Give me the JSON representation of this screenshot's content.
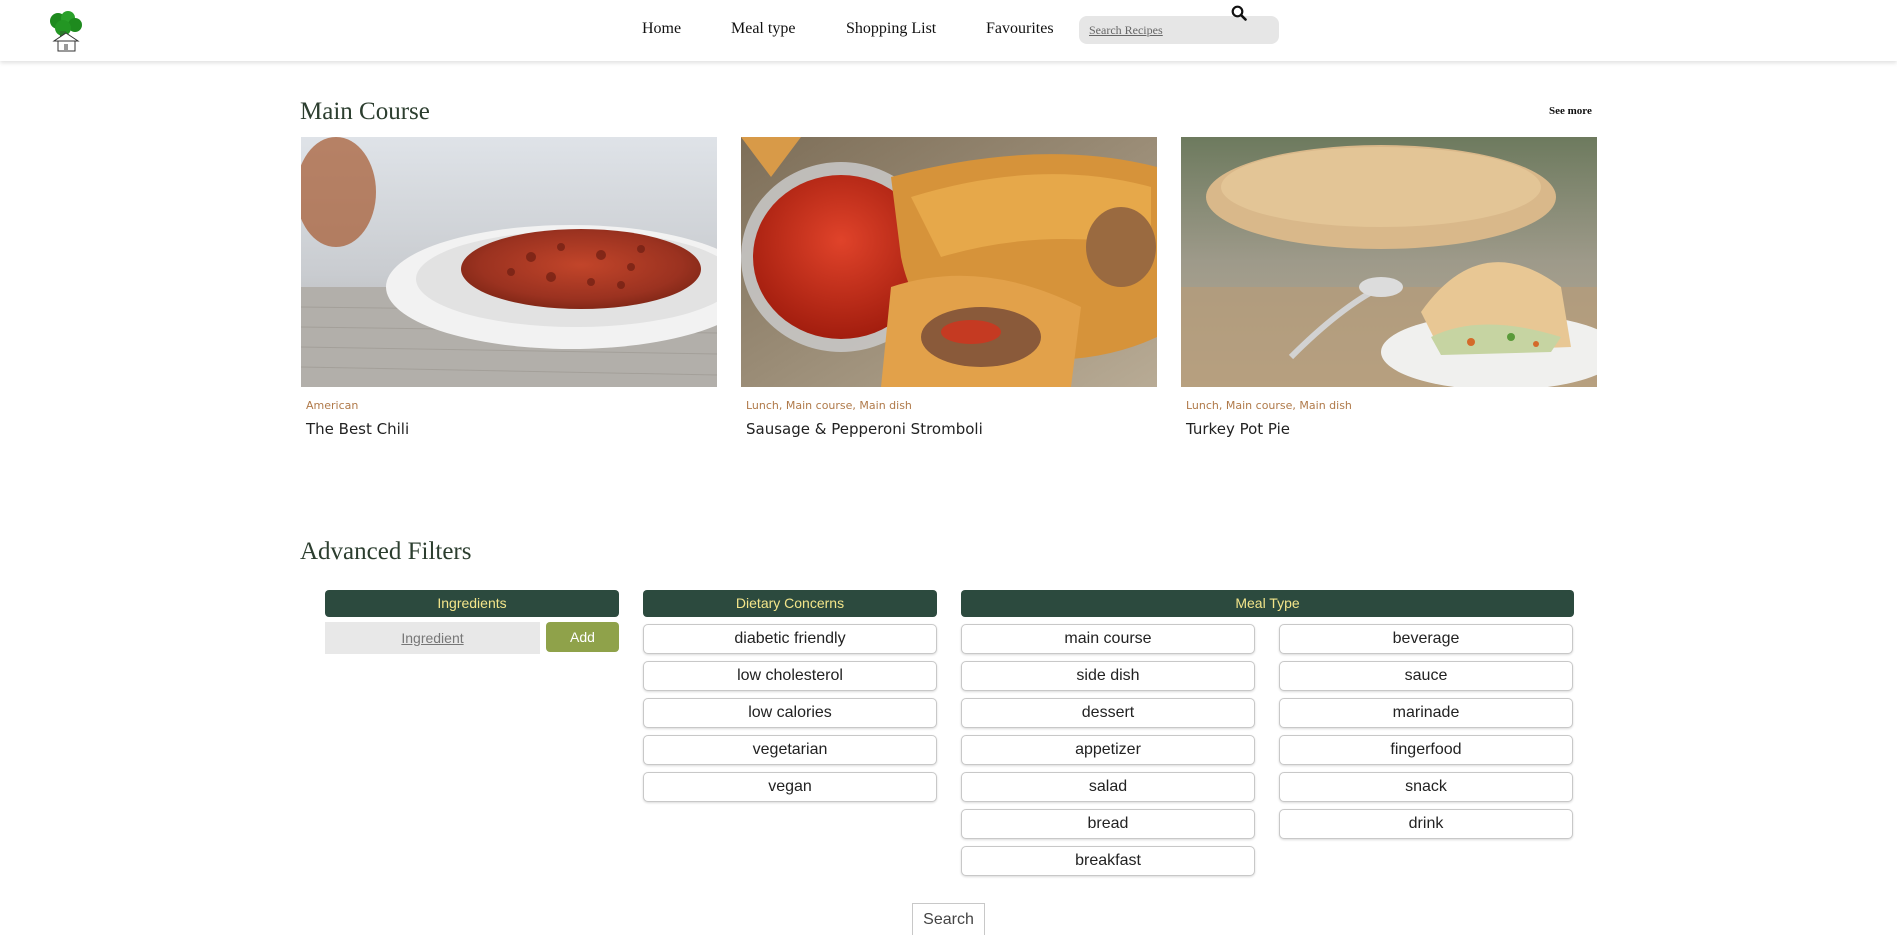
{
  "header": {
    "nav": [
      {
        "label": "Home"
      },
      {
        "label": "Meal type"
      },
      {
        "label": "Shopping List"
      },
      {
        "label": "Favourites"
      }
    ],
    "search": {
      "placeholder": "Search Recipes"
    },
    "logo_icon": "broccoli-house-icon",
    "search_icon": "magnifier-icon"
  },
  "main_course": {
    "title": "Main Course",
    "see_more": "See more",
    "cards": [
      {
        "tags": "American",
        "title": "The Best Chili",
        "image": "chili-bowl-photo"
      },
      {
        "tags": "Lunch, Main course, Main dish",
        "title": "Sausage & Pepperoni Stromboli",
        "image": "stromboli-photo"
      },
      {
        "tags": "Lunch, Main course, Main dish",
        "title": "Turkey Pot Pie",
        "image": "pot-pie-photo"
      }
    ]
  },
  "filters": {
    "title": "Advanced Filters",
    "ingredients": {
      "header": "Ingredients",
      "placeholder": "Ingredient",
      "add_label": "Add"
    },
    "dietary": {
      "header": "Dietary Concerns",
      "options": [
        "diabetic friendly",
        "low cholesterol",
        "low calories",
        "vegetarian",
        "vegan"
      ]
    },
    "meal_type": {
      "header": "Meal Type",
      "col1": [
        "main course",
        "side dish",
        "dessert",
        "appetizer",
        "salad",
        "bread",
        "breakfast"
      ],
      "col2": [
        "beverage",
        "sauce",
        "marinade",
        "fingerfood",
        "snack",
        "drink"
      ]
    },
    "search_label": "Search"
  },
  "colors": {
    "accent_dark": "#2c4a3e",
    "accent_text": "#f3e58a",
    "add_button": "#8fa24a",
    "tag_text": "#b07a4a"
  }
}
